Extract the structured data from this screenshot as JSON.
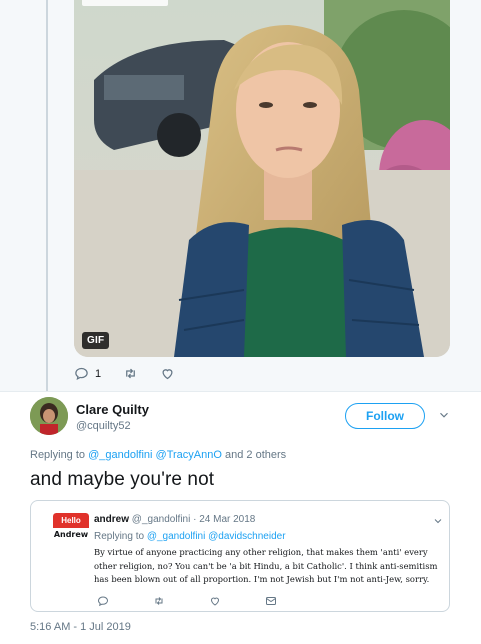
{
  "parent_tweet": {
    "gif_badge": "GIF",
    "actions": {
      "reply_count": "1"
    }
  },
  "tweet": {
    "author": {
      "display_name": "Clare Quilty",
      "handle": "@cquilty52"
    },
    "follow_label": "Follow",
    "replying_prefix": "Replying to",
    "replying_mentions": "@_gandolfini @TracyAnnO",
    "replying_suffix": "and 2 others",
    "text": "and maybe you're not",
    "timestamp": "5:16 AM - 1 Jul 2019"
  },
  "quoted_tweet": {
    "avatar_top": "Hello",
    "avatar_bottom": "Andrew",
    "author_name": "andrew",
    "author_handle": "@_gandolfini",
    "date": "· 24 Mar 2018",
    "replying_prefix": "Replying to",
    "replying_mentions": "@_gandolfini @davidschneider",
    "body": "By virtue of anyone practicing any other religion,  that makes them 'anti' every other religion, no?  You can't be 'a bit Hindu, a bit Catholic'.  I think anti-semitism has been blown out of all proportion.  I'm not Jewish but I'm not anti-Jew, sorry."
  },
  "colors": {
    "accent": "#1da1f2",
    "muted": "#657786",
    "background_parent": "#f5f8fa"
  },
  "icons": [
    "reply-icon",
    "retweet-icon",
    "like-icon",
    "dm-icon",
    "chevron-down-icon"
  ]
}
